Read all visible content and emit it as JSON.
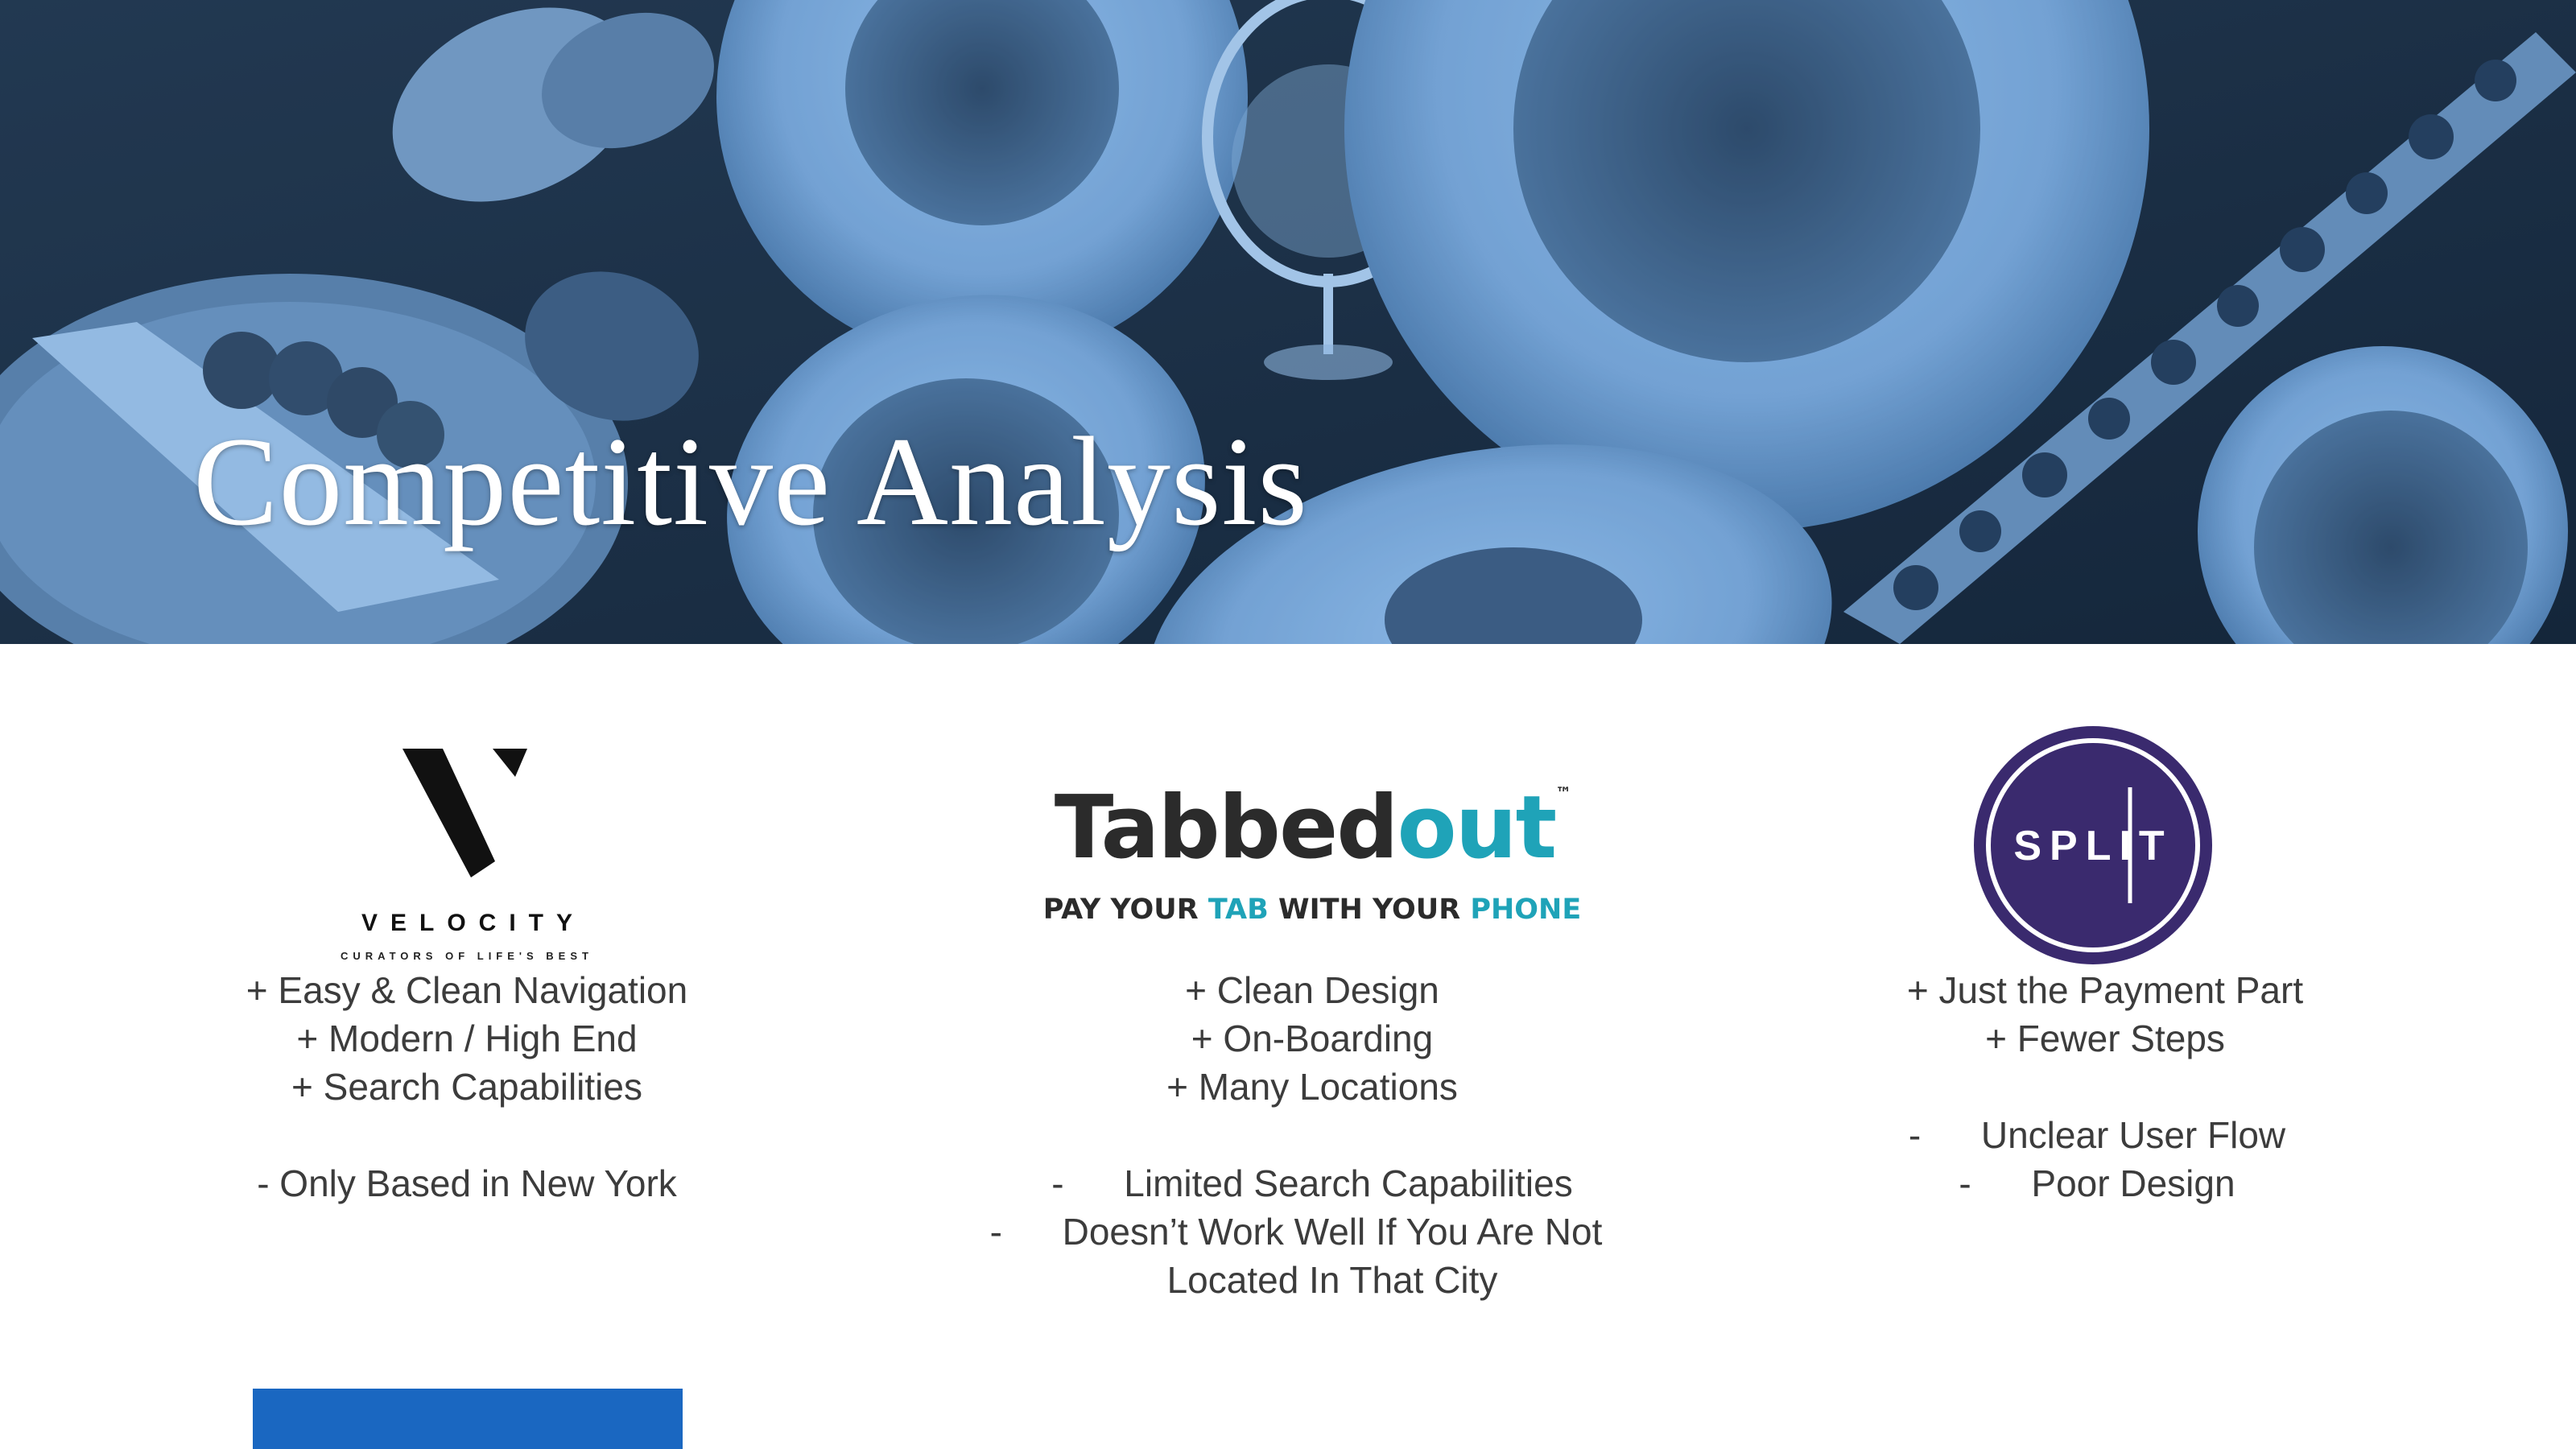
{
  "slide": {
    "title": "Competitive Analysis",
    "accent_color": "#1a67c1",
    "hero_tint": "#7fb0e0"
  },
  "competitors": [
    {
      "brand": "VELOCITY",
      "tagline": "CURATORS OF LIFE'S BEST",
      "pros": [
        "+ Easy & Clean Navigation",
        "+ Modern / High End",
        "+ Search Capabilities"
      ],
      "cons": [
        "- Only Based in New York"
      ]
    },
    {
      "brand_part_1": "Tabbed",
      "brand_part_2": "out",
      "brand_tm": "™",
      "tagline_part_1": "PAY YOUR ",
      "tagline_part_2": "TAB",
      "tagline_part_3": " WITH YOUR ",
      "tagline_part_4": "PHONE",
      "brand_teal": "#1fa3b8",
      "pros": [
        "+ Clean Design",
        "+ On-Boarding",
        "+ Many Locations"
      ],
      "cons": [
        "Limited Search Capabilities",
        "Doesn’t Work Well If You Are Not"
      ],
      "cons_continuation": "Located In That City",
      "dash": "-"
    },
    {
      "brand": "SPLIT",
      "brand_color": "#3a2a6e",
      "pros": [
        "+ Just the Payment Part",
        "+ Fewer Steps"
      ],
      "cons": [
        "Unclear User Flow",
        "Poor Design"
      ],
      "dash": "-"
    }
  ]
}
